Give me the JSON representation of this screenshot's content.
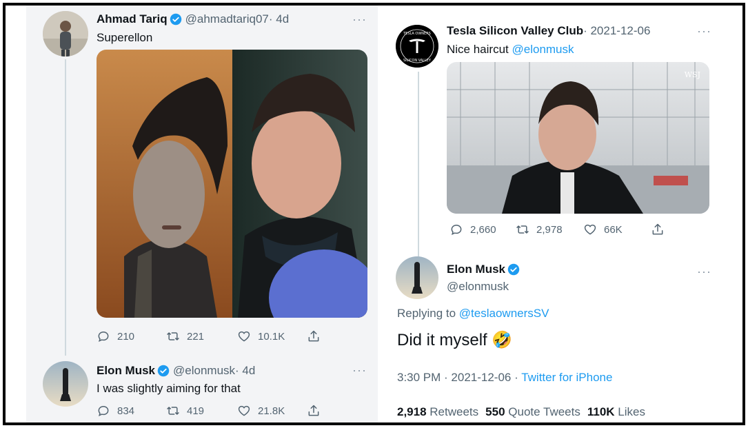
{
  "left": {
    "tweet1": {
      "name": "Ahmad Tariq",
      "handle": "@ahmadtariq07",
      "time": "· 4d",
      "text": "Superellon",
      "actions": {
        "replies": "210",
        "retweets": "221",
        "likes": "10.1K"
      }
    },
    "tweet2": {
      "name": "Elon Musk",
      "handle": "@elonmusk",
      "time": "· 4d",
      "text": "I was slightly aiming for that",
      "actions": {
        "replies": "834",
        "retweets": "419",
        "likes": "21.8K"
      }
    }
  },
  "right": {
    "tweet1": {
      "name": "Tesla Silicon Valley Club",
      "time": "· 2021-12-06",
      "text_prefix": "Nice haircut",
      "mention": "@elonmusk",
      "avatar_text_top": "TESLA OWNERS",
      "avatar_text_bottom": "SILICON VALLEY",
      "media_watermark": "WSJ",
      "actions": {
        "replies": "2,660",
        "retweets": "2,978",
        "likes": "66K"
      }
    },
    "tweet2": {
      "name": "Elon Musk",
      "handle": "@elonmusk",
      "replying_prefix": "Replying to",
      "replying_to": "@teslaownersSV",
      "text": "Did it myself",
      "emoji": "🤣",
      "timestamp": "3:30 PM · 2021-12-06 ·",
      "source": "Twitter for iPhone",
      "stats": {
        "retweets_count": "2,918",
        "retweets_label": "Retweets",
        "quotes_count": "550",
        "quotes_label": "Quote Tweets",
        "likes_count": "110K",
        "likes_label": "Likes"
      }
    }
  },
  "more_glyph": "···",
  "colors": {
    "accent": "#1d9bf0",
    "secondary_text": "#536471",
    "verified": "#1d9bf0"
  }
}
